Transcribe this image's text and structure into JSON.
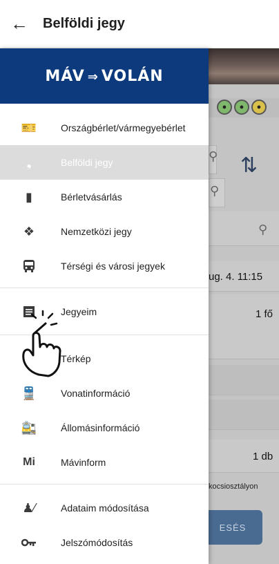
{
  "appbar": {
    "title": "Belföldi jegy",
    "back_icon": "arrow-left-icon"
  },
  "drawer": {
    "logo": "MÁV VOLÁN",
    "brand_color": "#0d3a7c",
    "items": [
      {
        "label": "Országbérlet/vármegyebérlet",
        "icon": "ticket-pass-icon"
      },
      {
        "label": "Belföldi jegy",
        "icon": "ticket-icon",
        "selected": true
      },
      {
        "label": "Bérletvásárlás",
        "icon": "pass-icon"
      },
      {
        "label": "Nemzetközi jegy",
        "icon": "international-ticket-icon"
      },
      {
        "label": "Térségi és városi jegyek",
        "icon": "bus-icon"
      },
      {
        "label": "Jegyeim",
        "icon": "receipt-icon"
      },
      {
        "label": "Térkép",
        "icon": "map-icon"
      },
      {
        "label": "Vonatinformáció",
        "icon": "train-info-icon"
      },
      {
        "label": "Állomásinformáció",
        "icon": "station-info-icon"
      },
      {
        "label": "Mávinform",
        "icon": "mavinform-icon"
      },
      {
        "label": "Adataim módosítása",
        "icon": "user-edit-icon"
      },
      {
        "label": "Jelszómódosítás",
        "icon": "key-icon"
      }
    ]
  },
  "background": {
    "date_value": "ug. 4. 11:15",
    "passengers_value": "1 fő",
    "count_value": "1 db",
    "class_value": "kocsiosztályon",
    "search_button": "ESÉS"
  }
}
